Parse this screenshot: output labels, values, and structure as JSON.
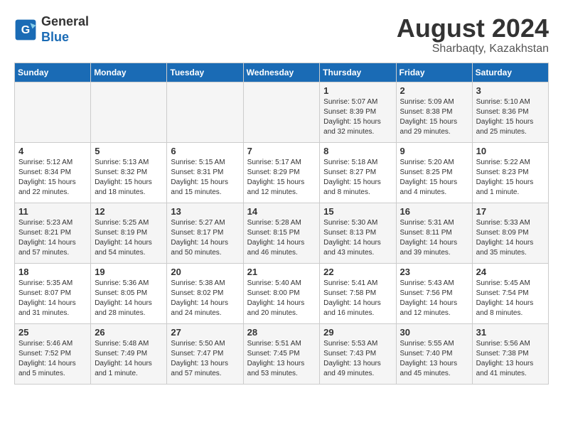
{
  "header": {
    "logo_line1": "General",
    "logo_line2": "Blue",
    "month_year": "August 2024",
    "location": "Sharbaqty, Kazakhstan"
  },
  "weekdays": [
    "Sunday",
    "Monday",
    "Tuesday",
    "Wednesday",
    "Thursday",
    "Friday",
    "Saturday"
  ],
  "weeks": [
    [
      {
        "day": "",
        "info": ""
      },
      {
        "day": "",
        "info": ""
      },
      {
        "day": "",
        "info": ""
      },
      {
        "day": "",
        "info": ""
      },
      {
        "day": "1",
        "info": "Sunrise: 5:07 AM\nSunset: 8:39 PM\nDaylight: 15 hours\nand 32 minutes."
      },
      {
        "day": "2",
        "info": "Sunrise: 5:09 AM\nSunset: 8:38 PM\nDaylight: 15 hours\nand 29 minutes."
      },
      {
        "day": "3",
        "info": "Sunrise: 5:10 AM\nSunset: 8:36 PM\nDaylight: 15 hours\nand 25 minutes."
      }
    ],
    [
      {
        "day": "4",
        "info": "Sunrise: 5:12 AM\nSunset: 8:34 PM\nDaylight: 15 hours\nand 22 minutes."
      },
      {
        "day": "5",
        "info": "Sunrise: 5:13 AM\nSunset: 8:32 PM\nDaylight: 15 hours\nand 18 minutes."
      },
      {
        "day": "6",
        "info": "Sunrise: 5:15 AM\nSunset: 8:31 PM\nDaylight: 15 hours\nand 15 minutes."
      },
      {
        "day": "7",
        "info": "Sunrise: 5:17 AM\nSunset: 8:29 PM\nDaylight: 15 hours\nand 12 minutes."
      },
      {
        "day": "8",
        "info": "Sunrise: 5:18 AM\nSunset: 8:27 PM\nDaylight: 15 hours\nand 8 minutes."
      },
      {
        "day": "9",
        "info": "Sunrise: 5:20 AM\nSunset: 8:25 PM\nDaylight: 15 hours\nand 4 minutes."
      },
      {
        "day": "10",
        "info": "Sunrise: 5:22 AM\nSunset: 8:23 PM\nDaylight: 15 hours\nand 1 minute."
      }
    ],
    [
      {
        "day": "11",
        "info": "Sunrise: 5:23 AM\nSunset: 8:21 PM\nDaylight: 14 hours\nand 57 minutes."
      },
      {
        "day": "12",
        "info": "Sunrise: 5:25 AM\nSunset: 8:19 PM\nDaylight: 14 hours\nand 54 minutes."
      },
      {
        "day": "13",
        "info": "Sunrise: 5:27 AM\nSunset: 8:17 PM\nDaylight: 14 hours\nand 50 minutes."
      },
      {
        "day": "14",
        "info": "Sunrise: 5:28 AM\nSunset: 8:15 PM\nDaylight: 14 hours\nand 46 minutes."
      },
      {
        "day": "15",
        "info": "Sunrise: 5:30 AM\nSunset: 8:13 PM\nDaylight: 14 hours\nand 43 minutes."
      },
      {
        "day": "16",
        "info": "Sunrise: 5:31 AM\nSunset: 8:11 PM\nDaylight: 14 hours\nand 39 minutes."
      },
      {
        "day": "17",
        "info": "Sunrise: 5:33 AM\nSunset: 8:09 PM\nDaylight: 14 hours\nand 35 minutes."
      }
    ],
    [
      {
        "day": "18",
        "info": "Sunrise: 5:35 AM\nSunset: 8:07 PM\nDaylight: 14 hours\nand 31 minutes."
      },
      {
        "day": "19",
        "info": "Sunrise: 5:36 AM\nSunset: 8:05 PM\nDaylight: 14 hours\nand 28 minutes."
      },
      {
        "day": "20",
        "info": "Sunrise: 5:38 AM\nSunset: 8:02 PM\nDaylight: 14 hours\nand 24 minutes."
      },
      {
        "day": "21",
        "info": "Sunrise: 5:40 AM\nSunset: 8:00 PM\nDaylight: 14 hours\nand 20 minutes."
      },
      {
        "day": "22",
        "info": "Sunrise: 5:41 AM\nSunset: 7:58 PM\nDaylight: 14 hours\nand 16 minutes."
      },
      {
        "day": "23",
        "info": "Sunrise: 5:43 AM\nSunset: 7:56 PM\nDaylight: 14 hours\nand 12 minutes."
      },
      {
        "day": "24",
        "info": "Sunrise: 5:45 AM\nSunset: 7:54 PM\nDaylight: 14 hours\nand 8 minutes."
      }
    ],
    [
      {
        "day": "25",
        "info": "Sunrise: 5:46 AM\nSunset: 7:52 PM\nDaylight: 14 hours\nand 5 minutes."
      },
      {
        "day": "26",
        "info": "Sunrise: 5:48 AM\nSunset: 7:49 PM\nDaylight: 14 hours\nand 1 minute."
      },
      {
        "day": "27",
        "info": "Sunrise: 5:50 AM\nSunset: 7:47 PM\nDaylight: 13 hours\nand 57 minutes."
      },
      {
        "day": "28",
        "info": "Sunrise: 5:51 AM\nSunset: 7:45 PM\nDaylight: 13 hours\nand 53 minutes."
      },
      {
        "day": "29",
        "info": "Sunrise: 5:53 AM\nSunset: 7:43 PM\nDaylight: 13 hours\nand 49 minutes."
      },
      {
        "day": "30",
        "info": "Sunrise: 5:55 AM\nSunset: 7:40 PM\nDaylight: 13 hours\nand 45 minutes."
      },
      {
        "day": "31",
        "info": "Sunrise: 5:56 AM\nSunset: 7:38 PM\nDaylight: 13 hours\nand 41 minutes."
      }
    ]
  ]
}
